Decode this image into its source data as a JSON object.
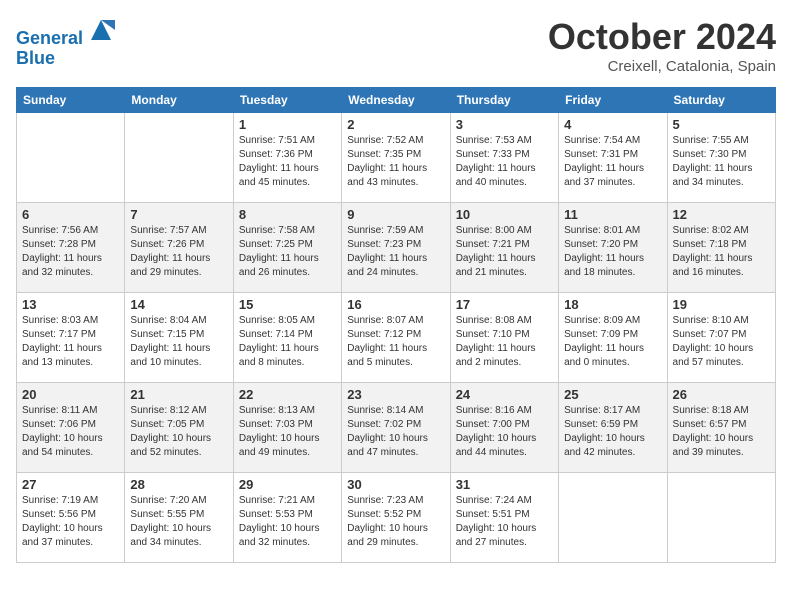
{
  "header": {
    "logo_line1": "General",
    "logo_line2": "Blue",
    "month": "October 2024",
    "location": "Creixell, Catalonia, Spain"
  },
  "days_of_week": [
    "Sunday",
    "Monday",
    "Tuesday",
    "Wednesday",
    "Thursday",
    "Friday",
    "Saturday"
  ],
  "weeks": [
    [
      {
        "num": "",
        "info": ""
      },
      {
        "num": "",
        "info": ""
      },
      {
        "num": "1",
        "info": "Sunrise: 7:51 AM\nSunset: 7:36 PM\nDaylight: 11 hours and 45 minutes."
      },
      {
        "num": "2",
        "info": "Sunrise: 7:52 AM\nSunset: 7:35 PM\nDaylight: 11 hours and 43 minutes."
      },
      {
        "num": "3",
        "info": "Sunrise: 7:53 AM\nSunset: 7:33 PM\nDaylight: 11 hours and 40 minutes."
      },
      {
        "num": "4",
        "info": "Sunrise: 7:54 AM\nSunset: 7:31 PM\nDaylight: 11 hours and 37 minutes."
      },
      {
        "num": "5",
        "info": "Sunrise: 7:55 AM\nSunset: 7:30 PM\nDaylight: 11 hours and 34 minutes."
      }
    ],
    [
      {
        "num": "6",
        "info": "Sunrise: 7:56 AM\nSunset: 7:28 PM\nDaylight: 11 hours and 32 minutes."
      },
      {
        "num": "7",
        "info": "Sunrise: 7:57 AM\nSunset: 7:26 PM\nDaylight: 11 hours and 29 minutes."
      },
      {
        "num": "8",
        "info": "Sunrise: 7:58 AM\nSunset: 7:25 PM\nDaylight: 11 hours and 26 minutes."
      },
      {
        "num": "9",
        "info": "Sunrise: 7:59 AM\nSunset: 7:23 PM\nDaylight: 11 hours and 24 minutes."
      },
      {
        "num": "10",
        "info": "Sunrise: 8:00 AM\nSunset: 7:21 PM\nDaylight: 11 hours and 21 minutes."
      },
      {
        "num": "11",
        "info": "Sunrise: 8:01 AM\nSunset: 7:20 PM\nDaylight: 11 hours and 18 minutes."
      },
      {
        "num": "12",
        "info": "Sunrise: 8:02 AM\nSunset: 7:18 PM\nDaylight: 11 hours and 16 minutes."
      }
    ],
    [
      {
        "num": "13",
        "info": "Sunrise: 8:03 AM\nSunset: 7:17 PM\nDaylight: 11 hours and 13 minutes."
      },
      {
        "num": "14",
        "info": "Sunrise: 8:04 AM\nSunset: 7:15 PM\nDaylight: 11 hours and 10 minutes."
      },
      {
        "num": "15",
        "info": "Sunrise: 8:05 AM\nSunset: 7:14 PM\nDaylight: 11 hours and 8 minutes."
      },
      {
        "num": "16",
        "info": "Sunrise: 8:07 AM\nSunset: 7:12 PM\nDaylight: 11 hours and 5 minutes."
      },
      {
        "num": "17",
        "info": "Sunrise: 8:08 AM\nSunset: 7:10 PM\nDaylight: 11 hours and 2 minutes."
      },
      {
        "num": "18",
        "info": "Sunrise: 8:09 AM\nSunset: 7:09 PM\nDaylight: 11 hours and 0 minutes."
      },
      {
        "num": "19",
        "info": "Sunrise: 8:10 AM\nSunset: 7:07 PM\nDaylight: 10 hours and 57 minutes."
      }
    ],
    [
      {
        "num": "20",
        "info": "Sunrise: 8:11 AM\nSunset: 7:06 PM\nDaylight: 10 hours and 54 minutes."
      },
      {
        "num": "21",
        "info": "Sunrise: 8:12 AM\nSunset: 7:05 PM\nDaylight: 10 hours and 52 minutes."
      },
      {
        "num": "22",
        "info": "Sunrise: 8:13 AM\nSunset: 7:03 PM\nDaylight: 10 hours and 49 minutes."
      },
      {
        "num": "23",
        "info": "Sunrise: 8:14 AM\nSunset: 7:02 PM\nDaylight: 10 hours and 47 minutes."
      },
      {
        "num": "24",
        "info": "Sunrise: 8:16 AM\nSunset: 7:00 PM\nDaylight: 10 hours and 44 minutes."
      },
      {
        "num": "25",
        "info": "Sunrise: 8:17 AM\nSunset: 6:59 PM\nDaylight: 10 hours and 42 minutes."
      },
      {
        "num": "26",
        "info": "Sunrise: 8:18 AM\nSunset: 6:57 PM\nDaylight: 10 hours and 39 minutes."
      }
    ],
    [
      {
        "num": "27",
        "info": "Sunrise: 7:19 AM\nSunset: 5:56 PM\nDaylight: 10 hours and 37 minutes."
      },
      {
        "num": "28",
        "info": "Sunrise: 7:20 AM\nSunset: 5:55 PM\nDaylight: 10 hours and 34 minutes."
      },
      {
        "num": "29",
        "info": "Sunrise: 7:21 AM\nSunset: 5:53 PM\nDaylight: 10 hours and 32 minutes."
      },
      {
        "num": "30",
        "info": "Sunrise: 7:23 AM\nSunset: 5:52 PM\nDaylight: 10 hours and 29 minutes."
      },
      {
        "num": "31",
        "info": "Sunrise: 7:24 AM\nSunset: 5:51 PM\nDaylight: 10 hours and 27 minutes."
      },
      {
        "num": "",
        "info": ""
      },
      {
        "num": "",
        "info": ""
      }
    ]
  ]
}
